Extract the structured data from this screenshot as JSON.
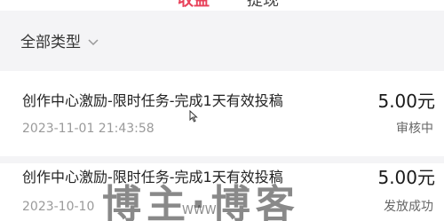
{
  "tabs": [
    {
      "label": "收益"
    },
    {
      "label": "提现"
    }
  ],
  "filter": {
    "label": "全部类型",
    "icon": "chevron-down-icon"
  },
  "records": [
    {
      "title": "创作中心激励-限时任务-完成1天有效投稿",
      "amount": "5.00元",
      "time": "2023-11-01 21:43:58",
      "status": "审核中"
    },
    {
      "title": "创作中心激励-限时任务-完成1天有效投稿",
      "amount": "5.00元",
      "time": "2023-10-10 ",
      "status": "发放成功"
    }
  ],
  "watermark": {
    "text": "博主·博客",
    "sub": "WWW"
  },
  "colors": {
    "accent": "#e8425a",
    "background": "#f4f4f6"
  }
}
